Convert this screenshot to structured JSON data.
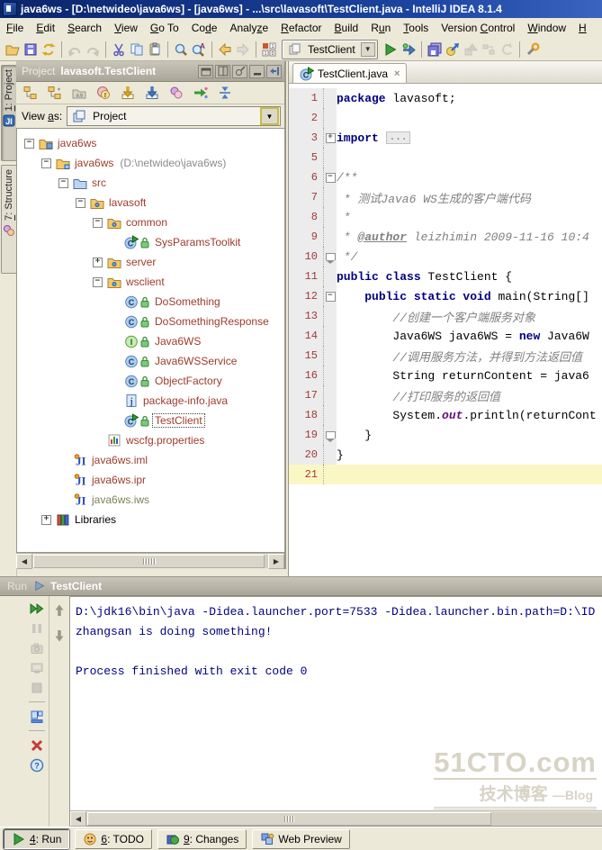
{
  "window": {
    "title": "java6ws - [D:\\netwideo\\java6ws] - [java6ws] - ...\\src\\lavasoft\\TestClient.java - IntelliJ IDEA 8.1.4"
  },
  "menu": {
    "items": [
      {
        "pre": "",
        "key": "F",
        "post": "ile"
      },
      {
        "pre": "",
        "key": "E",
        "post": "dit"
      },
      {
        "pre": "",
        "key": "S",
        "post": "earch"
      },
      {
        "pre": "",
        "key": "V",
        "post": "iew"
      },
      {
        "pre": "",
        "key": "G",
        "post": "o To"
      },
      {
        "pre": "Co",
        "key": "d",
        "post": "e"
      },
      {
        "pre": "Analy",
        "key": "z",
        "post": "e"
      },
      {
        "pre": "",
        "key": "R",
        "post": "efactor"
      },
      {
        "pre": "",
        "key": "B",
        "post": "uild"
      },
      {
        "pre": "R",
        "key": "u",
        "post": "n"
      },
      {
        "pre": "",
        "key": "T",
        "post": "ools"
      },
      {
        "pre": "Version ",
        "key": "C",
        "post": "ontrol"
      },
      {
        "pre": "",
        "key": "W",
        "post": "indow"
      },
      {
        "pre": "",
        "key": "H",
        "post": ""
      }
    ]
  },
  "toolbar": {
    "run_config": "TestClient",
    "left_icons": [
      {
        "icon": "open",
        "enabled": true
      },
      {
        "icon": "save",
        "enabled": true
      },
      {
        "icon": "sync",
        "enabled": true
      },
      {
        "icon": "sep"
      },
      {
        "icon": "undo",
        "enabled": false
      },
      {
        "icon": "redo",
        "enabled": false
      },
      {
        "icon": "sep"
      },
      {
        "icon": "cut",
        "enabled": true
      },
      {
        "icon": "copy",
        "enabled": true
      },
      {
        "icon": "paste",
        "enabled": true
      },
      {
        "icon": "sep"
      },
      {
        "icon": "find",
        "enabled": true
      },
      {
        "icon": "find-in-path",
        "enabled": true
      },
      {
        "icon": "sep"
      },
      {
        "icon": "back",
        "enabled": true
      },
      {
        "icon": "forward",
        "enabled": false
      },
      {
        "icon": "sep"
      },
      {
        "icon": "run-config-grid",
        "enabled": true
      }
    ],
    "right_icons": [
      {
        "icon": "run",
        "enabled": true
      },
      {
        "icon": "debug",
        "enabled": true
      },
      {
        "icon": "sep"
      },
      {
        "icon": "save-all",
        "enabled": true
      },
      {
        "icon": "export",
        "enabled": true
      },
      {
        "icon": "shapes",
        "enabled": false
      },
      {
        "icon": "dependencies",
        "enabled": false
      },
      {
        "icon": "rollback",
        "enabled": false
      },
      {
        "icon": "sep"
      },
      {
        "icon": "settings",
        "enabled": true
      }
    ]
  },
  "tool_stripes": {
    "left": [
      {
        "num": "1",
        "rest": ": Project",
        "icon": "stripe-project",
        "active": true
      },
      {
        "num": "7",
        "rest": ": Structure",
        "icon": "stripe-structure",
        "active": false
      }
    ]
  },
  "project_panel": {
    "title_prefix": "Project",
    "title": "lavasoft.TestClient",
    "header_icons": [
      "float",
      "dock",
      "pin",
      "hide",
      "collapse-panel"
    ],
    "toolbar_icons": [
      "flatten-packages",
      "show-modules",
      "abbreviate-packages",
      "show-members",
      "autoscroll-to-source",
      "autoscroll-from-source",
      "module-groups",
      "select-in",
      "collapse-all"
    ],
    "view_as_label_pre": "View ",
    "view_as_label_key": "a",
    "view_as_label_post": "s:",
    "view_as_value": "Project",
    "tree": [
      {
        "d": 0,
        "h": "-",
        "i": "project",
        "t": "java6ws"
      },
      {
        "d": 1,
        "h": "-",
        "i": "module",
        "t": "java6ws",
        "x": " (D:\\netwideo\\java6ws)"
      },
      {
        "d": 2,
        "h": "-",
        "i": "srcfolder",
        "t": "src"
      },
      {
        "d": 3,
        "h": "-",
        "i": "package",
        "t": "lavasoft"
      },
      {
        "d": 4,
        "h": "-",
        "i": "package",
        "t": "common"
      },
      {
        "d": 5,
        "i": "runclass",
        "lock": true,
        "t": "SysParamsToolkit"
      },
      {
        "d": 4,
        "h": "+",
        "i": "package",
        "t": "server"
      },
      {
        "d": 4,
        "h": "-",
        "i": "package",
        "t": "wsclient"
      },
      {
        "d": 5,
        "i": "class",
        "lock": true,
        "t": "DoSomething"
      },
      {
        "d": 5,
        "i": "class",
        "lock": true,
        "t": "DoSomethingResponse"
      },
      {
        "d": 5,
        "i": "iface",
        "lock": true,
        "t": "Java6WS"
      },
      {
        "d": 5,
        "i": "class",
        "lock": true,
        "t": "Java6WSService"
      },
      {
        "d": 5,
        "i": "class",
        "lock": true,
        "t": "ObjectFactory"
      },
      {
        "d": 5,
        "i": "jfile",
        "t": "package-info.java"
      },
      {
        "d": 5,
        "i": "runclass",
        "lock": true,
        "t": "TestClient",
        "sel": true
      },
      {
        "d": 4,
        "i": "props",
        "t": "wscfg.properties"
      },
      {
        "d": 2,
        "i": "idea",
        "t": "java6ws.iml"
      },
      {
        "d": 2,
        "i": "idea",
        "t": "java6ws.ipr"
      },
      {
        "d": 2,
        "i": "idea",
        "t": "java6ws.iws",
        "cls": "ign"
      },
      {
        "d": 1,
        "h": "+",
        "i": "lib",
        "t": "Libraries",
        "cls": "blk"
      }
    ]
  },
  "editor": {
    "tab_label": "TestClient.java",
    "lines": [
      {
        "n": "1",
        "segs": [
          {
            "t": "package",
            "c": "kw"
          },
          {
            "t": " lavasoft;",
            "c": "pl"
          }
        ]
      },
      {
        "n": "2",
        "segs": []
      },
      {
        "n": "3",
        "fold": "plus",
        "segs": [
          {
            "t": "import",
            "c": "kw"
          },
          {
            "t": " ",
            "c": "pl"
          },
          {
            "t": "...",
            "c": "foldbox"
          }
        ]
      },
      {
        "n": "5",
        "segs": []
      },
      {
        "n": "6",
        "fold": "start",
        "segs": [
          {
            "t": "/**",
            "c": "cmt"
          }
        ]
      },
      {
        "n": "7",
        "segs": [
          {
            "t": " * 测试Java6 WS生成的客户端代码",
            "c": "cmt"
          }
        ]
      },
      {
        "n": "8",
        "segs": [
          {
            "t": " *",
            "c": "cmt"
          }
        ]
      },
      {
        "n": "9",
        "segs": [
          {
            "t": " * ",
            "c": "cmt"
          },
          {
            "t": "@author",
            "c": "tag"
          },
          {
            "t": " leizhimin 2009-11-16 10:4",
            "c": "cmt"
          }
        ]
      },
      {
        "n": "10",
        "fold": "end",
        "segs": [
          {
            "t": " */",
            "c": "cmt"
          }
        ]
      },
      {
        "n": "11",
        "segs": [
          {
            "t": "public class",
            "c": "kw"
          },
          {
            "t": " TestClient {",
            "c": "pl"
          }
        ]
      },
      {
        "n": "12",
        "fold": "start",
        "segs": [
          {
            "t": "    ",
            "c": "pl"
          },
          {
            "t": "public static void",
            "c": "kw"
          },
          {
            "t": " main(String[]",
            "c": "pl"
          }
        ]
      },
      {
        "n": "13",
        "segs": [
          {
            "t": "        //创建一个客户端服务对象",
            "c": "cmt"
          }
        ]
      },
      {
        "n": "14",
        "segs": [
          {
            "t": "        Java6WS java6WS = ",
            "c": "pl"
          },
          {
            "t": "new",
            "c": "kw"
          },
          {
            "t": " Java6W",
            "c": "pl"
          }
        ]
      },
      {
        "n": "15",
        "segs": [
          {
            "t": "        //调用服务方法，并得到方法返回值",
            "c": "cmt"
          }
        ]
      },
      {
        "n": "16",
        "segs": [
          {
            "t": "        String returnContent = java6",
            "c": "pl"
          }
        ]
      },
      {
        "n": "17",
        "segs": [
          {
            "t": "        //打印服务的返回值",
            "c": "cmt"
          }
        ]
      },
      {
        "n": "18",
        "segs": [
          {
            "t": "        System.",
            "c": "pl"
          },
          {
            "t": "out",
            "c": "fld"
          },
          {
            "t": ".println(returnCont",
            "c": "pl"
          }
        ]
      },
      {
        "n": "19",
        "fold": "end",
        "segs": [
          {
            "t": "    }",
            "c": "pl"
          }
        ]
      },
      {
        "n": "20",
        "segs": [
          {
            "t": "}",
            "c": "pl"
          }
        ]
      },
      {
        "n": "21",
        "cur": true,
        "segs": []
      }
    ]
  },
  "run_panel": {
    "label": "Run",
    "tab": "TestClient",
    "tool_icons": [
      "rerun",
      "pause",
      "dump-threads",
      "console-settings",
      "stop",
      "sep",
      "restore-layout",
      "sep",
      "close",
      "help"
    ],
    "nav_icons": [
      "up",
      "down"
    ],
    "console_lines": [
      "D:\\jdk16\\bin\\java -Didea.launcher.port=7533 -Didea.launcher.bin.path=D:\\ID",
      "zhangsan is doing something!",
      "",
      "Process finished with exit code 0"
    ]
  },
  "status_bar": {
    "tabs": [
      {
        "num": "4",
        "rest": ": Run",
        "icon": "status-run",
        "active": true
      },
      {
        "num": "6",
        "rest": ": TODO",
        "icon": "status-todo",
        "active": false
      },
      {
        "num": "9",
        "rest": ": Changes",
        "icon": "status-changes",
        "active": false
      },
      {
        "num": "",
        "rest": "Web Preview",
        "icon": "status-web",
        "active": false
      }
    ]
  },
  "watermark": {
    "line1": "51CTO.com",
    "line2": "技术博客",
    "line3": "—Blog"
  }
}
